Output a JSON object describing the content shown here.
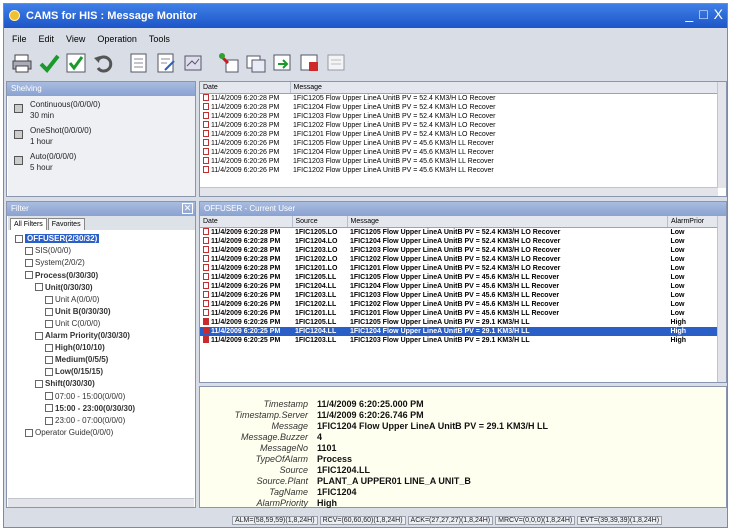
{
  "window": {
    "title": "CAMS for HIS : Message Monitor",
    "controls": [
      "_",
      "□",
      "X"
    ]
  },
  "menu": [
    "File",
    "Edit",
    "View",
    "Operation",
    "Tools"
  ],
  "toolbar_icons": [
    "print-icon",
    "acknowledge-check-icon",
    "acknowledge-all-icon",
    "undo-icon",
    "list-icon",
    "list-edit-icon",
    "shelve-icon",
    "alarm-filter-icon",
    "window-icon",
    "window-arrow-icon",
    "window-red-icon",
    "window-blank-icon"
  ],
  "shelving": {
    "title": "Shelving",
    "items": [
      {
        "name": "Continuous(0/0/0/0)",
        "duration": "30 min"
      },
      {
        "name": "OneShot(0/0/0/0)",
        "duration": "1 hour"
      },
      {
        "name": "Auto(0/0/0/0)",
        "duration": "5 hour"
      }
    ]
  },
  "top_list": {
    "columns": [
      "Date",
      "Message"
    ],
    "rows": [
      [
        "11/4/2009 6:20:28 PM",
        "1FIC1205   Flow Upper LineA UnitB  PV =  52.4 KM3/H  LO   Recover"
      ],
      [
        "11/4/2009 6:20:28 PM",
        "1FIC1204   Flow Upper LineA UnitB  PV =  52.4 KM3/H  LO   Recover"
      ],
      [
        "11/4/2009 6:20:28 PM",
        "1FIC1203   Flow Upper LineA UnitB  PV =  52.4 KM3/H  LO   Recover"
      ],
      [
        "11/4/2009 6:20:28 PM",
        "1FIC1202   Flow Upper LineA UnitB  PV =  52.4 KM3/H  LO   Recover"
      ],
      [
        "11/4/2009 6:20:28 PM",
        "1FIC1201   Flow Upper LineA UnitB  PV =  52.4 KM3/H  LO   Recover"
      ],
      [
        "11/4/2009 6:20:26 PM",
        "1FIC1205   Flow Upper LineA UnitB  PV =  45.6 KM3/H  LL   Recover"
      ],
      [
        "11/4/2009 6:20:26 PM",
        "1FIC1204   Flow Upper LineA UnitB  PV =  45.6 KM3/H  LL   Recover"
      ],
      [
        "11/4/2009 6:20:26 PM",
        "1FIC1203   Flow Upper LineA UnitB  PV =  45.6 KM3/H  LL   Recover"
      ],
      [
        "11/4/2009 6:20:26 PM",
        "1FIC1202   Flow Upper LineA UnitB  PV =  45.6 KM3/H  LL   Recover"
      ]
    ]
  },
  "filter": {
    "title": "Filter",
    "tabs": [
      "All Filters",
      "Favorites"
    ],
    "tree": [
      "OFFUSER(2/30/32)",
      "SIS(0/0/0)",
      "System(2/0/2)",
      "Process(0/30/30)",
      "Unit(0/30/30)",
      "Unit A(0/0/0)",
      "Unit B(0/30/30)",
      "Unit C(0/0/0)",
      "Alarm Priority(0/30/30)",
      "High(0/10/10)",
      "Medium(0/5/5)",
      "Low(0/15/15)",
      "Shift(0/30/30)",
      "07:00 - 15:00(0/0/0)",
      "15:00 - 23:00(0/30/30)",
      "23:00 - 07:00(0/0/0)",
      "Operator Guide(0/0/0)"
    ]
  },
  "main_list": {
    "title": "OFFUSER - Current User",
    "columns": [
      "Date",
      "Source",
      "Message",
      "AlarmPrior"
    ],
    "rows": [
      [
        "11/4/2009 6:20:28 PM",
        "1FIC1205.LO",
        "1FIC1205   Flow Upper LineA UnitB  PV =  52.4 KM3/H   LO   Recover",
        "Low"
      ],
      [
        "11/4/2009 6:20:28 PM",
        "1FIC1204.LO",
        "1FIC1204   Flow Upper LineA UnitB  PV =  52.4 KM3/H   LO   Recover",
        "Low"
      ],
      [
        "11/4/2009 6:20:28 PM",
        "1FIC1203.LO",
        "1FIC1203   Flow Upper LineA UnitB  PV =  52.4 KM3/H   LO   Recover",
        "Low"
      ],
      [
        "11/4/2009 6:20:28 PM",
        "1FIC1202.LO",
        "1FIC1202   Flow Upper LineA UnitB  PV =  52.4 KM3/H   LO   Recover",
        "Low"
      ],
      [
        "11/4/2009 6:20:28 PM",
        "1FIC1201.LO",
        "1FIC1201   Flow Upper LineA UnitB  PV =  52.4 KM3/H   LO   Recover",
        "Low"
      ],
      [
        "11/4/2009 6:20:26 PM",
        "1FIC1205.LL",
        "1FIC1205   Flow Upper LineA UnitB  PV =  45.6 KM3/H   LL   Recover",
        "Low"
      ],
      [
        "11/4/2009 6:20:26 PM",
        "1FIC1204.LL",
        "1FIC1204   Flow Upper LineA UnitB  PV =  45.6 KM3/H   LL   Recover",
        "Low"
      ],
      [
        "11/4/2009 6:20:26 PM",
        "1FIC1203.LL",
        "1FIC1203   Flow Upper LineA UnitB  PV =  45.6 KM3/H   LL   Recover",
        "Low"
      ],
      [
        "11/4/2009 6:20:26 PM",
        "1FIC1202.LL",
        "1FIC1202   Flow Upper LineA UnitB  PV =  45.6 KM3/H   LL   Recover",
        "Low"
      ],
      [
        "11/4/2009 6:20:26 PM",
        "1FIC1201.LL",
        "1FIC1201   Flow Upper LineA UnitB  PV =  45.6 KM3/H   LL   Recover",
        "Low"
      ],
      [
        "11/4/2009 6:20:26 PM",
        "1FIC1205.LL",
        "1FIC1205   Flow Upper LineA UnitB  PV =  29.1 KM3/H   LL",
        "High"
      ],
      [
        "11/4/2009 6:20:25 PM",
        "1FIC1204.LL",
        "1FIC1204   Flow Upper LineA UnitB  PV =  29.1 KM3/H   LL",
        "High"
      ],
      [
        "11/4/2009 6:20:25 PM",
        "1FIC1203.LL",
        "1FIC1203   Flow Upper LineA UnitB  PV =  29.1 KM3/H   LL",
        "High"
      ]
    ],
    "selected_index": 11
  },
  "detail": [
    [
      "Timestamp",
      "11/4/2009 6:20:25.000 PM"
    ],
    [
      "Timestamp.Server",
      "11/4/2009 6:20:26.746 PM"
    ],
    [
      "Message",
      "1FIC1204 Flow Upper LineA UnitB PV = 29.1 KM3/H LL"
    ],
    [
      "Message.Buzzer",
      "4"
    ],
    [
      "MessageNo",
      "1101"
    ],
    [
      "TypeOfAlarm",
      "Process"
    ],
    [
      "Source",
      "1FIC1204.LL"
    ],
    [
      "Source.Plant",
      "PLANT_A UPPER01 LINE_A UNIT_B"
    ],
    [
      "TagName",
      "1FIC1204"
    ],
    [
      "AlarmPriority",
      "High"
    ]
  ],
  "status": [
    "ALM=(58,59,59)(1,8,24H)",
    "RCV=(60,60,60)(1,8,24H)",
    "ACK=(27,27,27)(1,8,24H)",
    "MRCV=(0,0,0)(1,8,24H)",
    "EVT=(39,39,39)(1,8,24H)"
  ]
}
